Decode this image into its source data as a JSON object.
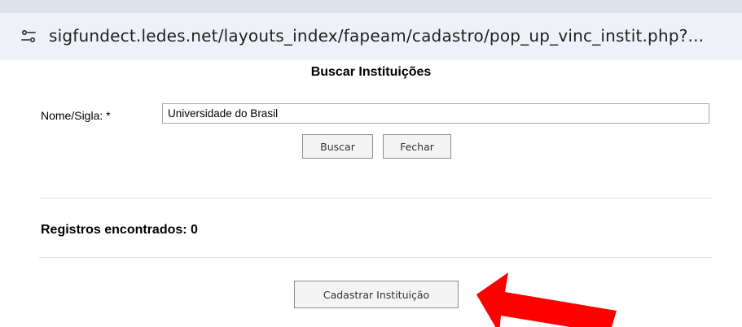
{
  "browser": {
    "url": "sigfundect.ledes.net/layouts_index/fapeam/cadastro/pop_up_vinc_instit.php?..."
  },
  "page": {
    "title": "Buscar Instituições",
    "search": {
      "label": "Nome/Sigla: *",
      "value": "Universidade do Brasil"
    },
    "buttons": {
      "search_label": "Buscar",
      "close_label": "Fechar",
      "register_label": "Cadastrar Instituição"
    },
    "records_text": "Registros encontrados: 0"
  },
  "annotation": {
    "arrow_color": "#ff0000"
  }
}
